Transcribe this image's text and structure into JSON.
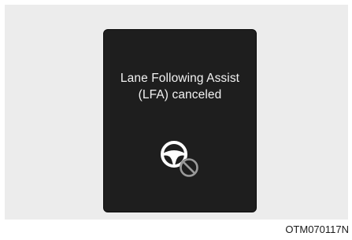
{
  "display": {
    "message_line1": "Lane Following Assist",
    "message_line2": "(LFA) canceled",
    "icon": "steering-wheel-cancel-icon"
  },
  "figure": {
    "code": "OTM070117N"
  },
  "colors": {
    "figure_background": "#ececec",
    "panel_background": "#1e1e1e",
    "text": "#f2f2f2",
    "icon_wheel": "#ffffff",
    "icon_cancel": "#9a9a9a"
  }
}
